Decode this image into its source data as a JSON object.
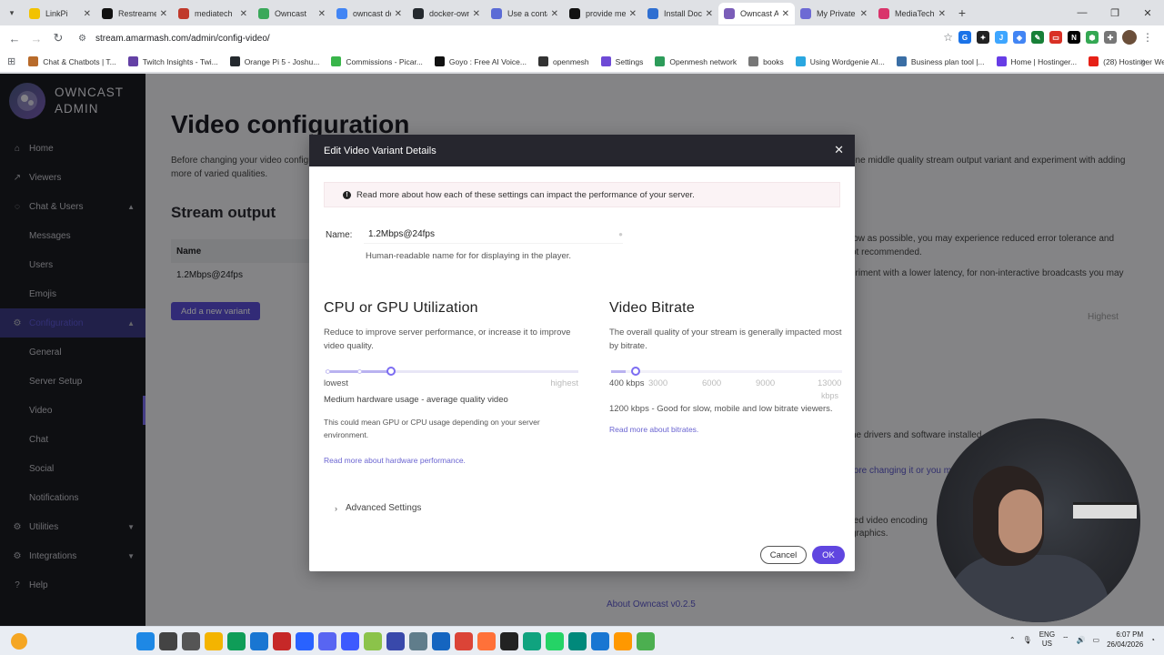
{
  "browser": {
    "tabs": [
      {
        "title": "LinkPi",
        "color": "#f2c200"
      },
      {
        "title": "Restreamer",
        "color": "#111111"
      },
      {
        "title": "mediatech",
        "color": "#c0392b"
      },
      {
        "title": "Owncast",
        "color": "#3aa85a"
      },
      {
        "title": "owncast do",
        "color": "#4285f4"
      },
      {
        "title": "docker-own",
        "color": "#24292e"
      },
      {
        "title": "Use a conta",
        "color": "#5b6bd6"
      },
      {
        "title": "provide me",
        "color": "#111111"
      },
      {
        "title": "Install Dock",
        "color": "#2f6fd1"
      },
      {
        "title": "Owncast A",
        "color": "#7a5db8"
      },
      {
        "title": "My Private",
        "color": "#6d6ad4"
      },
      {
        "title": "MediaTech",
        "color": "#d9346b"
      }
    ],
    "active_tab": 9,
    "url": "stream.amarmash.com/admin/config-video/",
    "bookmarks": [
      {
        "label": "Chat & Chatbots | T...",
        "color": "#b86b2b"
      },
      {
        "label": "Twitch Insights - Twi...",
        "color": "#6441a5"
      },
      {
        "label": "Orange Pi 5 - Joshu...",
        "color": "#24292e"
      },
      {
        "label": "Commissions - Picar...",
        "color": "#39b54a"
      },
      {
        "label": "Goyo : Free AI Voice...",
        "color": "#111111"
      },
      {
        "label": "openmesh",
        "color": "#333333"
      },
      {
        "label": "Settings",
        "color": "#6e4ad6"
      },
      {
        "label": "Openmesh network",
        "color": "#2d9c5a"
      },
      {
        "label": "books",
        "color": "#777777"
      },
      {
        "label": "Using Wordgenie AI...",
        "color": "#2aa7e0"
      },
      {
        "label": "Business plan tool |...",
        "color": "#3a6ea5"
      },
      {
        "label": "Home | Hostinger...",
        "color": "#673de6"
      },
      {
        "label": "(28) Hostinger Web...",
        "color": "#e62117"
      }
    ]
  },
  "sidebar": {
    "brand_line1": "OWNCAST",
    "brand_line2": "ADMIN",
    "items": [
      {
        "label": "Home",
        "icon": "home-icon",
        "glyph": "⌂"
      },
      {
        "label": "Viewers",
        "icon": "chart-icon",
        "glyph": "↗"
      },
      {
        "label": "Chat & Users",
        "icon": "chat-icon",
        "glyph": "◌",
        "chevron": "▲"
      },
      {
        "label": "Messages",
        "sub": true
      },
      {
        "label": "Users",
        "sub": true
      },
      {
        "label": "Emojis",
        "sub": true
      },
      {
        "label": "Configuration",
        "icon": "settings-icon",
        "glyph": "⚙",
        "chevron": "▲",
        "section_active": true
      },
      {
        "label": "General",
        "sub": true
      },
      {
        "label": "Server Setup",
        "sub": true
      },
      {
        "label": "Video",
        "sub": true,
        "current": true
      },
      {
        "label": "Chat",
        "sub": true
      },
      {
        "label": "Social",
        "sub": true
      },
      {
        "label": "Notifications",
        "sub": true
      },
      {
        "label": "Utilities",
        "icon": "tool-icon",
        "glyph": "⚙",
        "chevron": "▼"
      },
      {
        "label": "Integrations",
        "icon": "integration-icon",
        "glyph": "⚙",
        "chevron": "▼"
      },
      {
        "label": "Help",
        "icon": "help-icon",
        "glyph": "?"
      }
    ]
  },
  "page": {
    "title": "Video configuration",
    "intro_line1": "Before changing your video configu",
    "intro_line2": "more of varied qualities.",
    "right_intro": "one middle quality stream output variant and experiment with adding",
    "latency_line1": "low as possible, you may experience reduced error tolerance and",
    "latency_line2": "ot recommended.",
    "latency_line3": "eriment with a lower latency, for non-interactive broadcasts you may",
    "highest": "Highest",
    "drivers": "he drivers and software installed",
    "changing": "fore changing it or you m",
    "encoding": "ted video encoding",
    "graphics": "graphics.",
    "stream_output": "Stream output",
    "table_header": "Name",
    "table_rows": [
      "1.2Mbps@24fps"
    ],
    "add_variant": "Add a new variant",
    "footer": "About Owncast v0.2.5"
  },
  "modal": {
    "title": "Edit Video Variant Details",
    "info": "Read more about how each of these settings can impact the performance of your server.",
    "name_label": "Name:",
    "name_value": "1.2Mbps@24fps",
    "name_help": "Human-readable name for for displaying in the player.",
    "cpu": {
      "title": "CPU or GPU Utilization",
      "desc": "Reduce to improve server performance, or increase it to improve video quality.",
      "low_label": "lowest",
      "high_label": "highest",
      "level": 0.5,
      "level_text": "Medium hardware usage - average quality video",
      "note": "This could mean GPU or CPU usage depending on your server environment.",
      "link": "Read more about hardware performance."
    },
    "bitrate": {
      "title": "Video Bitrate",
      "desc": "The overall quality of your stream is generally impacted most by bitrate.",
      "value_kbps": 1200,
      "min_kbps": 400,
      "max_kbps": 13000,
      "ticks": [
        "400 kbps",
        "3000",
        "6000",
        "9000",
        "13000"
      ],
      "unit": "kbps",
      "value_text": "1200 kbps - Good for slow, mobile and low bitrate viewers.",
      "link": "Read more about bitrates."
    },
    "advanced": "Advanced Settings",
    "cancel": "Cancel",
    "ok": "OK"
  },
  "taskbar": {
    "lang": "ENG",
    "region": "US",
    "time": "6:07 PM",
    "date": "26/04/2026",
    "apps": [
      {
        "name": "start-icon",
        "color": "#1e88e5"
      },
      {
        "name": "search-icon",
        "color": "#444444"
      },
      {
        "name": "task-view-icon",
        "color": "#555555"
      },
      {
        "name": "file-explorer-icon",
        "color": "#f4b400"
      },
      {
        "name": "edge-icon",
        "color": "#0f9d58"
      },
      {
        "name": "store-icon",
        "color": "#1976d2"
      },
      {
        "name": "filezilla-icon",
        "color": "#c62828"
      },
      {
        "name": "messenger-icon",
        "color": "#2962ff"
      },
      {
        "name": "discord-icon",
        "color": "#5865f2"
      },
      {
        "name": "app-icon",
        "color": "#3d5afe"
      },
      {
        "name": "android-icon",
        "color": "#8bc34a"
      },
      {
        "name": "app-icon",
        "color": "#3949ab"
      },
      {
        "name": "app-icon",
        "color": "#607d8b"
      },
      {
        "name": "vpn-icon",
        "color": "#1565c0"
      },
      {
        "name": "chrome-icon",
        "color": "#db4437"
      },
      {
        "name": "firefox-icon",
        "color": "#ff7139"
      },
      {
        "name": "obs-icon",
        "color": "#222222"
      },
      {
        "name": "chatgpt-icon",
        "color": "#10a37f"
      },
      {
        "name": "whatsapp-icon",
        "color": "#25d366"
      },
      {
        "name": "app-icon",
        "color": "#00897b"
      },
      {
        "name": "app-icon",
        "color": "#1976d2"
      },
      {
        "name": "app-icon",
        "color": "#ff9800"
      },
      {
        "name": "app-icon",
        "color": "#4caf50"
      }
    ]
  }
}
